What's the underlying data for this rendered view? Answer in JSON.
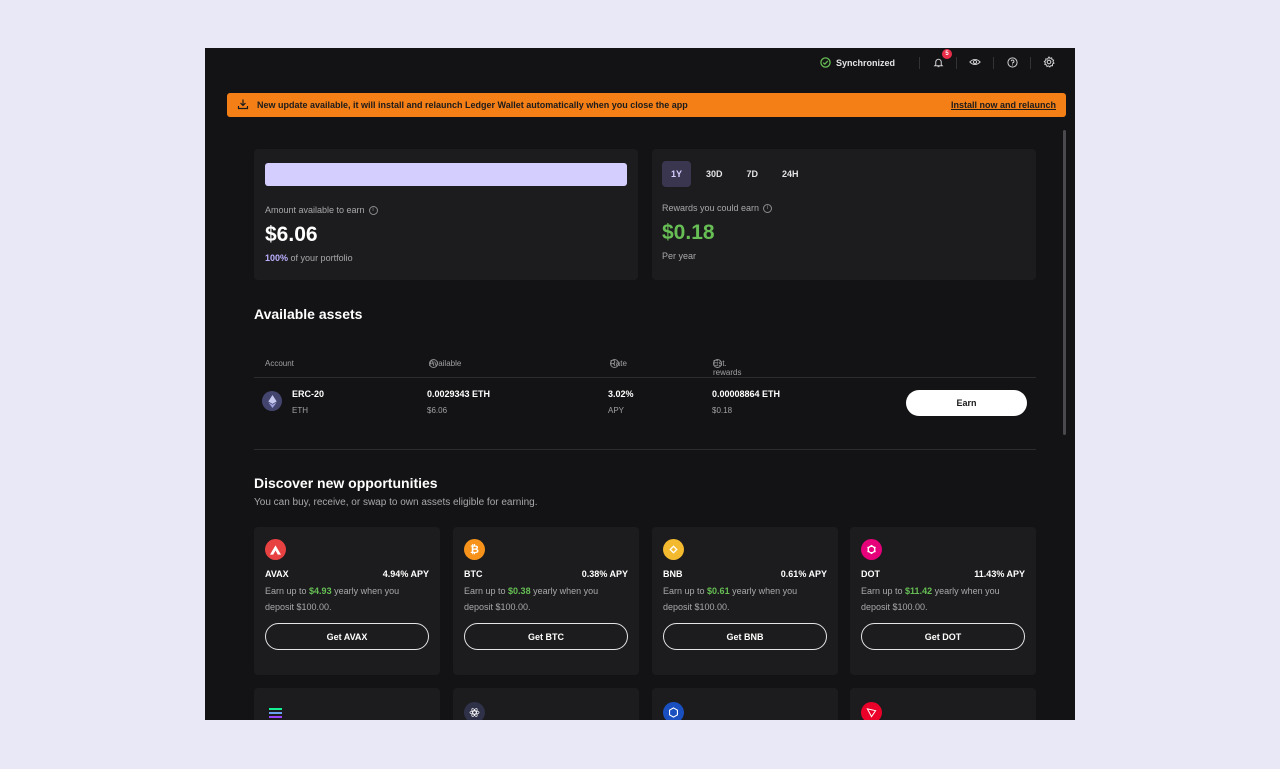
{
  "topbar": {
    "sync_label": "Synchronized",
    "notification_count": "5"
  },
  "banner": {
    "message": "New update available, it will install and relaunch Ledger Wallet automatically when you close the app",
    "link": "Install now and relaunch"
  },
  "summary": {
    "available_label": "Amount available to earn",
    "available_value": "$6.06",
    "portfolio_pct": "100%",
    "portfolio_suffix": "of your portfolio",
    "periods": [
      "1Y",
      "30D",
      "7D",
      "24H"
    ],
    "active_period": "1Y",
    "rewards_label": "Rewards you could earn",
    "rewards_value": "$0.18",
    "rewards_sub": "Per year"
  },
  "assets": {
    "title": "Available assets",
    "columns": [
      "Account",
      "Available",
      "Rate",
      "Est. rewards"
    ],
    "rows": [
      {
        "name": "ERC-20",
        "ticker": "ETH",
        "available": "0.0029343 ETH",
        "available_fiat": "$6.06",
        "rate": "3.02%",
        "rate_sub": "APY",
        "rewards": "0.00008864 ETH",
        "rewards_fiat": "$0.18",
        "button": "Earn"
      }
    ]
  },
  "discover": {
    "title": "Discover new opportunities",
    "subtitle": "You can buy, receive, or swap to own assets eligible for earning.",
    "desc_prefix": "Earn up to",
    "desc_mid": "yearly when you",
    "desc_suffix": "deposit $100.00.",
    "cards": [
      {
        "ticker": "AVAX",
        "apy": "4.94% APY",
        "earn": "$4.93",
        "button": "Get AVAX",
        "color": "#e84142"
      },
      {
        "ticker": "BTC",
        "apy": "0.38% APY",
        "earn": "$0.38",
        "button": "Get BTC",
        "color": "#f7931a"
      },
      {
        "ticker": "BNB",
        "apy": "0.61% APY",
        "earn": "$0.61",
        "button": "Get BNB",
        "color": "#f3ba2f"
      },
      {
        "ticker": "DOT",
        "apy": "11.43% APY",
        "earn": "$11.42",
        "button": "Get DOT",
        "color": "#e6007a"
      }
    ]
  },
  "colors": {
    "accent_purple": "#d4ceff",
    "positive_green": "#66be54",
    "banner_orange": "#f57f17"
  }
}
